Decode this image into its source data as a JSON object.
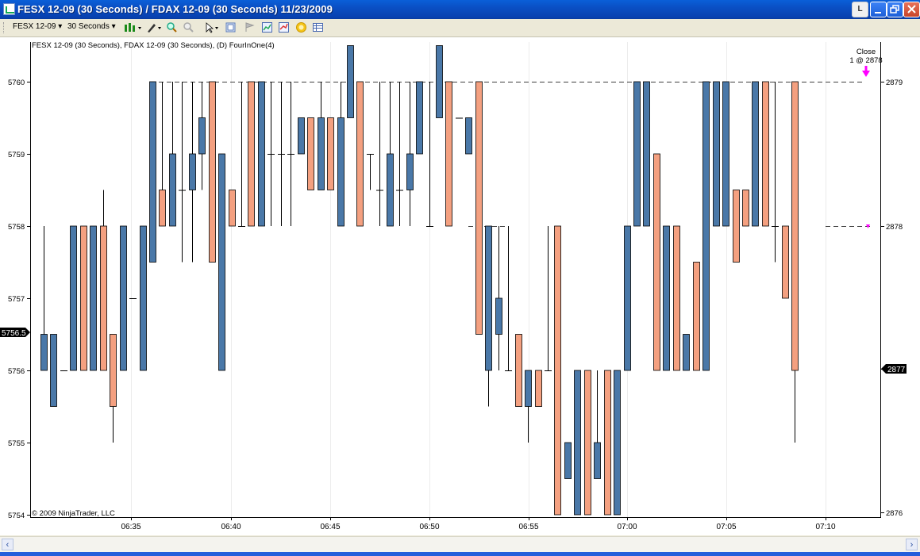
{
  "window": {
    "title": "FESX 12-09 (30 Seconds) / FDAX 12-09 (30 Seconds)  11/23/2009",
    "buttons": {
      "l": "L"
    }
  },
  "toolbar": {
    "instrument": "FESX 12-09",
    "interval": "30 Seconds",
    "icons": [
      "candlestick-icon",
      "pencil-icon",
      "zoom-in-icon",
      "zoom-out-icon",
      "cursor-icon",
      "properties-icon",
      "flag-icon",
      "chart-icon",
      "chart-trader-icon",
      "coin-icon",
      "grid-icon"
    ]
  },
  "chart": {
    "header": "FESX 12-09 (30 Seconds), FDAX 12-09 (30 Seconds), (D) FourInOne(4)",
    "copyright": "© 2009 NinjaTrader, LLC",
    "annotation": {
      "line1": "Close",
      "line2": "1 @ 2878"
    },
    "left_price_marker": "5756.5",
    "right_price_marker": "2877",
    "colors": {
      "blue": "#4a78a8",
      "orange": "#f4a080",
      "arrow": "#ff00ff"
    }
  },
  "chart_data": {
    "type": "candlestick",
    "left_axis": {
      "ticks": [
        "5760",
        "5759",
        "5758",
        "5757",
        "5756",
        "5755",
        "5754"
      ],
      "range": [
        5754,
        5760.5
      ]
    },
    "right_axis": {
      "ticks": [
        "2879",
        "2878",
        "2877",
        "2876"
      ]
    },
    "x_ticks": [
      "06:35",
      "06:40",
      "06:45",
      "06:50",
      "06:55",
      "07:00",
      "07:05",
      "07:10"
    ],
    "bars": [
      {
        "c": "b",
        "o": 5756.5,
        "h": 5758,
        "l": 5756,
        "cl": 5756
      },
      {
        "c": "b",
        "o": 5756.5,
        "h": 5756.5,
        "l": 5755.5,
        "cl": 5755.5
      },
      {
        "c": "n",
        "o": 5756,
        "h": 5756,
        "l": 5756,
        "cl": 5756
      },
      {
        "c": "b",
        "o": 5756,
        "h": 5758,
        "l": 5756,
        "cl": 5758
      },
      {
        "c": "o",
        "o": 5758,
        "h": 5758,
        "l": 5756,
        "cl": 5756
      },
      {
        "c": "b",
        "o": 5756,
        "h": 5758,
        "l": 5756,
        "cl": 5758
      },
      {
        "c": "o",
        "o": 5758,
        "h": 5758.5,
        "l": 5756,
        "cl": 5756
      },
      {
        "c": "o",
        "o": 5756.5,
        "h": 5756.5,
        "l": 5755,
        "cl": 5755.5
      },
      {
        "c": "b",
        "o": 5756,
        "h": 5758,
        "l": 5756,
        "cl": 5758
      },
      {
        "c": "n",
        "o": 5757,
        "h": 5757,
        "l": 5757,
        "cl": 5757
      },
      {
        "c": "b",
        "o": 5756,
        "h": 5758,
        "l": 5756,
        "cl": 5758
      },
      {
        "c": "b",
        "o": 5757.5,
        "h": 5760,
        "l": 5757.5,
        "cl": 5760
      },
      {
        "c": "o",
        "o": 5758.5,
        "h": 5760,
        "l": 5758,
        "cl": 5758
      },
      {
        "c": "b",
        "o": 5758,
        "h": 5760,
        "l": 5758,
        "cl": 5759
      },
      {
        "c": "n",
        "o": 5758.5,
        "h": 5760,
        "l": 5757.5,
        "cl": 5758.5
      },
      {
        "c": "b",
        "o": 5758.5,
        "h": 5760,
        "l": 5757.5,
        "cl": 5759
      },
      {
        "c": "b",
        "o": 5759,
        "h": 5760,
        "l": 5758.5,
        "cl": 5759.5
      },
      {
        "c": "o",
        "o": 5760,
        "h": 5760,
        "l": 5757.5,
        "cl": 5757.5
      },
      {
        "c": "b",
        "o": 5759,
        "h": 5759,
        "l": 5756,
        "cl": 5756
      },
      {
        "c": "o",
        "o": 5758.5,
        "h": 5758.5,
        "l": 5758,
        "cl": 5758
      },
      {
        "c": "n",
        "o": 5758,
        "h": 5760,
        "l": 5758,
        "cl": 5758
      },
      {
        "c": "o",
        "o": 5760,
        "h": 5760,
        "l": 5758,
        "cl": 5758
      },
      {
        "c": "b",
        "o": 5758,
        "h": 5760,
        "l": 5758,
        "cl": 5760
      },
      {
        "c": "n",
        "o": 5759,
        "h": 5760,
        "l": 5758,
        "cl": 5759
      },
      {
        "c": "n",
        "o": 5759,
        "h": 5760,
        "l": 5758,
        "cl": 5759
      },
      {
        "c": "n",
        "o": 5759,
        "h": 5760,
        "l": 5758,
        "cl": 5759
      },
      {
        "c": "b",
        "o": 5759,
        "h": 5759.5,
        "l": 5759,
        "cl": 5759.5
      },
      {
        "c": "o",
        "o": 5759.5,
        "h": 5759.5,
        "l": 5758.5,
        "cl": 5758.5
      },
      {
        "c": "b",
        "o": 5758.5,
        "h": 5760,
        "l": 5758.5,
        "cl": 5759.5
      },
      {
        "c": "o",
        "o": 5759.5,
        "h": 5759.5,
        "l": 5758.5,
        "cl": 5758.5
      },
      {
        "c": "b",
        "o": 5758,
        "h": 5760,
        "l": 5758,
        "cl": 5759.5
      },
      {
        "c": "b",
        "o": 5759.5,
        "h": 5760.5,
        "l": 5759.5,
        "cl": 5760.5
      },
      {
        "c": "o",
        "o": 5760,
        "h": 5760,
        "l": 5758,
        "cl": 5758
      },
      {
        "c": "n",
        "o": 5759,
        "h": 5759,
        "l": 5758.5,
        "cl": 5759
      },
      {
        "c": "n",
        "o": 5758.5,
        "h": 5760,
        "l": 5758,
        "cl": 5758.5
      },
      {
        "c": "b",
        "o": 5758,
        "h": 5760,
        "l": 5758,
        "cl": 5759
      },
      {
        "c": "n",
        "o": 5758.5,
        "h": 5760,
        "l": 5758,
        "cl": 5758.5
      },
      {
        "c": "b",
        "o": 5758.5,
        "h": 5760,
        "l": 5758,
        "cl": 5759
      },
      {
        "c": "b",
        "o": 5759,
        "h": 5760,
        "l": 5759,
        "cl": 5760
      },
      {
        "c": "n",
        "o": 5758,
        "h": 5760,
        "l": 5758,
        "cl": 5758
      },
      {
        "c": "b",
        "o": 5759.5,
        "h": 5760.5,
        "l": 5759.5,
        "cl": 5760.5
      },
      {
        "c": "o",
        "o": 5760,
        "h": 5760,
        "l": 5758,
        "cl": 5758
      },
      {
        "c": "n",
        "o": 5759.5,
        "h": 5759.5,
        "l": 5759.5,
        "cl": 5759.5
      },
      {
        "c": "b",
        "o": 5759,
        "h": 5759.5,
        "l": 5759,
        "cl": 5759.5
      },
      {
        "c": "o",
        "o": 5760,
        "h": 5760,
        "l": 5756.5,
        "cl": 5756.5
      },
      {
        "c": "b",
        "o": 5756,
        "h": 5758,
        "l": 5755.5,
        "cl": 5758
      },
      {
        "c": "b",
        "o": 5756.5,
        "h": 5758,
        "l": 5756,
        "cl": 5757
      },
      {
        "c": "n",
        "o": 5756,
        "h": 5758,
        "l": 5756,
        "cl": 5756
      },
      {
        "c": "o",
        "o": 5756.5,
        "h": 5756.5,
        "l": 5755.5,
        "cl": 5755.5
      },
      {
        "c": "b",
        "o": 5755.5,
        "h": 5756,
        "l": 5755,
        "cl": 5756
      },
      {
        "c": "o",
        "o": 5756,
        "h": 5756,
        "l": 5755.5,
        "cl": 5755.5
      },
      {
        "c": "n",
        "o": 5756,
        "h": 5758,
        "l": 5756,
        "cl": 5756
      },
      {
        "c": "o",
        "o": 5758,
        "h": 5758,
        "l": 5754,
        "cl": 5754
      },
      {
        "c": "b",
        "o": 5754.5,
        "h": 5755,
        "l": 5754.5,
        "cl": 5755
      },
      {
        "c": "b",
        "o": 5754,
        "h": 5756,
        "l": 5754,
        "cl": 5756
      },
      {
        "c": "o",
        "o": 5756,
        "h": 5756,
        "l": 5754,
        "cl": 5754
      },
      {
        "c": "b",
        "o": 5754.5,
        "h": 5756,
        "l": 5754.5,
        "cl": 5755
      },
      {
        "c": "o",
        "o": 5756,
        "h": 5756,
        "l": 5754,
        "cl": 5754
      },
      {
        "c": "b",
        "o": 5754,
        "h": 5756,
        "l": 5754,
        "cl": 5756
      },
      {
        "c": "b",
        "o": 5756,
        "h": 5758,
        "l": 5756,
        "cl": 5758
      },
      {
        "c": "b",
        "o": 5758,
        "h": 5760,
        "l": 5758,
        "cl": 5760
      },
      {
        "c": "b",
        "o": 5758,
        "h": 5760,
        "l": 5758,
        "cl": 5760
      },
      {
        "c": "o",
        "o": 5759,
        "h": 5759,
        "l": 5756,
        "cl": 5756
      },
      {
        "c": "b",
        "o": 5756,
        "h": 5758,
        "l": 5756,
        "cl": 5758
      },
      {
        "c": "o",
        "o": 5758,
        "h": 5758,
        "l": 5756,
        "cl": 5756
      },
      {
        "c": "b",
        "o": 5756,
        "h": 5756.5,
        "l": 5756,
        "cl": 5756.5
      },
      {
        "c": "o",
        "o": 5757.5,
        "h": 5757.5,
        "l": 5756,
        "cl": 5756
      },
      {
        "c": "b",
        "o": 5756,
        "h": 5760,
        "l": 5756,
        "cl": 5760
      },
      {
        "c": "b",
        "o": 5758,
        "h": 5760,
        "l": 5758,
        "cl": 5760
      },
      {
        "c": "b",
        "o": 5758,
        "h": 5760,
        "l": 5758,
        "cl": 5760
      },
      {
        "c": "o",
        "o": 5758.5,
        "h": 5758.5,
        "l": 5757.5,
        "cl": 5757.5
      },
      {
        "c": "o",
        "o": 5758.5,
        "h": 5758.5,
        "l": 5758,
        "cl": 5758
      },
      {
        "c": "b",
        "o": 5758,
        "h": 5760,
        "l": 5758,
        "cl": 5760
      },
      {
        "c": "o",
        "o": 5760,
        "h": 5760,
        "l": 5758,
        "cl": 5758
      },
      {
        "c": "n",
        "o": 5758,
        "h": 5760,
        "l": 5757.5,
        "cl": 5758
      },
      {
        "c": "o",
        "o": 5758,
        "h": 5758,
        "l": 5757,
        "cl": 5757
      },
      {
        "c": "o",
        "o": 5760,
        "h": 5760,
        "l": 5755,
        "cl": 5756
      }
    ]
  }
}
